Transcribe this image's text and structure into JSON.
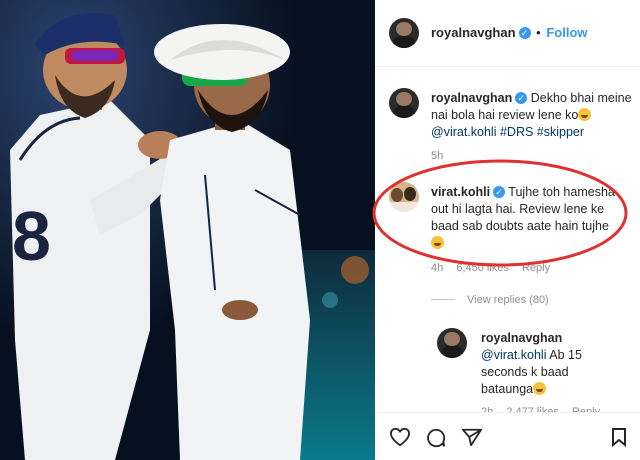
{
  "header": {
    "username": "royalnavghan",
    "separator": "•",
    "follow_label": "Follow"
  },
  "comments": [
    {
      "username": "royalnavghan",
      "text_line1": "Dekho bhai meine",
      "text_line2": "nai bola hai review lene ko",
      "mention": "@virat.kohli",
      "hashtags": "#DRS #skipper",
      "time": "5h"
    },
    {
      "username": "virat.kohli",
      "text_line1": "Tujhe toh hamesha",
      "text_line2": "out hi lagta hai. Review lene ke",
      "text_line3": "baad sab doubts aate hain tujhe",
      "time": "4h",
      "likes": "6,450 likes",
      "reply_label": "Reply",
      "view_replies": "View replies (80)"
    },
    {
      "username": "royalnavghan",
      "mention": "@virat.kohli",
      "text_after_mention": "Ab 15",
      "text_line2": "seconds k baad",
      "text_line3": "bataunga",
      "time": "2h",
      "likes": "2,477 likes",
      "reply_label": "Reply"
    }
  ],
  "action_icons": [
    "heart-icon",
    "comment-icon",
    "share-icon"
  ],
  "colors": {
    "accent": "#3897f0",
    "highlight": "#e03030",
    "photo_bg": "#0a1428"
  }
}
